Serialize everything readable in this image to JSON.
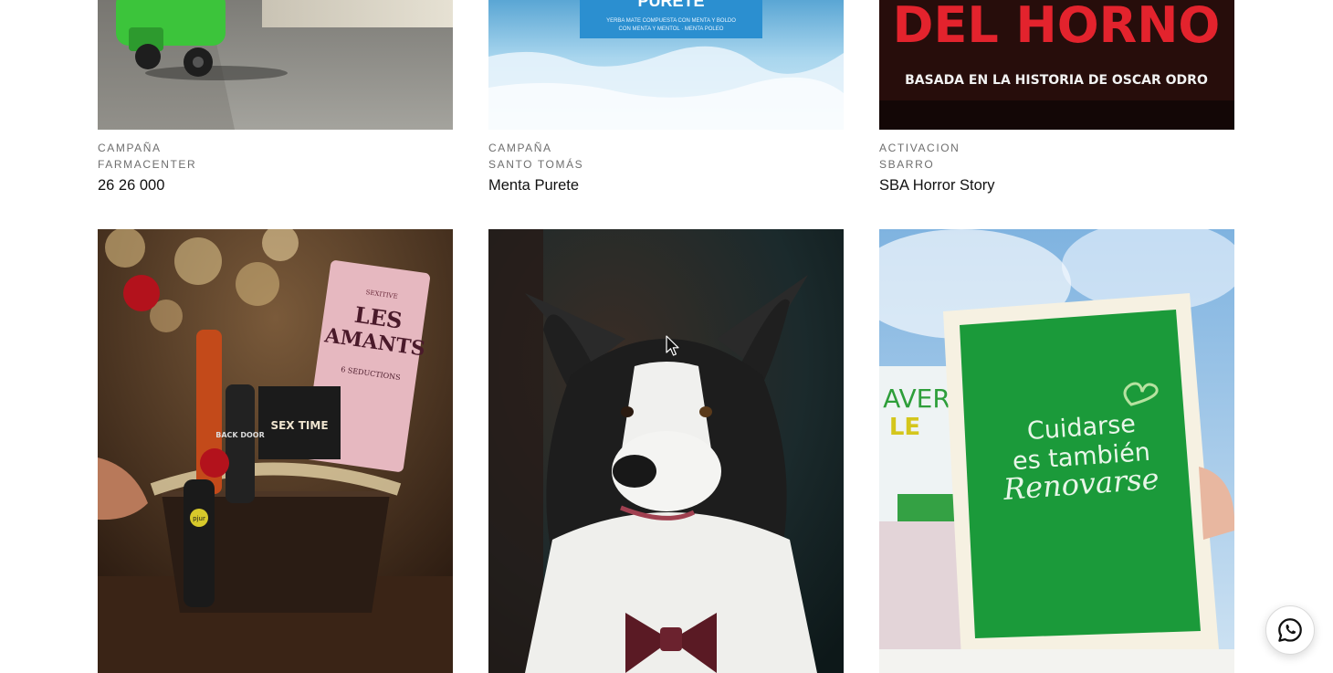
{
  "projects_row1": [
    {
      "type": "CAMPAÑA",
      "client": "FARMACENTER",
      "title": "26 26 000"
    },
    {
      "type": "CAMPAÑA",
      "client": "SANTO TOMÁS",
      "title": "Menta Purete"
    },
    {
      "type": "ACTIVACION",
      "client": "SBARRO",
      "title": "SBA Horror Story"
    }
  ],
  "image_text": {
    "purete_brand": "PURETE",
    "purete_fine_print_1": "YERBA MATE COMPUESTA CON MENTA Y BOLDO",
    "purete_fine_print_2": "CON MENTA Y MENTOL · MENTA POLEO",
    "horror_title": "DEL HORNO",
    "horror_subtitle": "BASADA EN LA HISTORIA DE OSCAR ODRO",
    "gift_brand": "SEXITIVE",
    "gift_box_1": "LES",
    "gift_box_2": "AMANTS",
    "gift_box_3": "6 SEDUCTIONS",
    "gift_box_4": "SEX TIME",
    "gift_bottle_1": "BACK DOOR",
    "gift_bottle_2": "pjur",
    "green_poster_1": "Cuidarse",
    "green_poster_2": "es también",
    "green_poster_3": "Renovarse",
    "green_poster_side_1": "AVERA",
    "green_poster_side_2": "LE"
  },
  "whatsapp": {
    "icon": "whatsapp-icon"
  }
}
